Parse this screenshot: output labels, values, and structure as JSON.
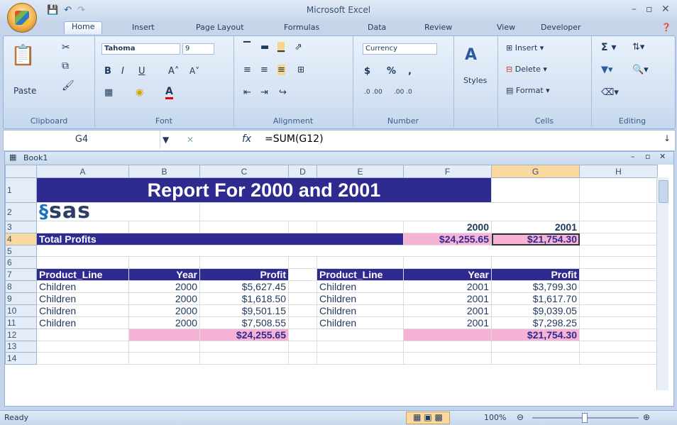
{
  "app": {
    "title": "Microsoft Excel"
  },
  "tabs": [
    "Home",
    "Insert",
    "Page Layout",
    "Formulas",
    "Data",
    "Review",
    "View",
    "Developer"
  ],
  "ribbon": {
    "clipboard": {
      "label": "Clipboard",
      "paste": "Paste"
    },
    "font": {
      "label": "Font",
      "name": "Tahoma",
      "size": "9",
      "bold": "B",
      "italic": "I",
      "underline": "U",
      "grow": "A˄",
      "shrink": "A˅",
      "font_color": "A"
    },
    "alignment": {
      "label": "Alignment"
    },
    "number": {
      "label": "Number",
      "format": "Currency",
      "dollar": "$",
      "percent": "%",
      "comma": ",",
      "inc_dec": ".0 .00",
      "dec_dec": ".00 .0"
    },
    "styles": {
      "label": "Styles"
    },
    "cells": {
      "label": "Cells",
      "insert": "Insert",
      "delete": "Delete",
      "format": "Format"
    },
    "editing": {
      "label": "Editing",
      "sum": "Σ"
    }
  },
  "formula_bar": {
    "name_box": "G4",
    "fx": "fx",
    "formula": "=SUM(G12)"
  },
  "workbook": {
    "title": "Book1"
  },
  "columns": [
    "A",
    "B",
    "C",
    "D",
    "E",
    "F",
    "G",
    "H"
  ],
  "rows": [
    "1",
    "2",
    "3",
    "4",
    "5",
    "6",
    "7",
    "8",
    "9",
    "10",
    "11",
    "12",
    "13",
    "14"
  ],
  "sheet": {
    "report_title": "Report For 2000 and 2001",
    "logo_text": "sas",
    "year_2000": "2000",
    "year_2001": "2001",
    "total_profits_label": "Total Profits",
    "total_2000": "$24,255.65",
    "total_2001": "$21,754.30",
    "headers": [
      "Product_Line",
      "Year",
      "Profit"
    ],
    "left_rows": [
      [
        "Children",
        "2000",
        "$5,627.45"
      ],
      [
        "Children",
        "2000",
        "$1,618.50"
      ],
      [
        "Children",
        "2000",
        "$9,501.15"
      ],
      [
        "Children",
        "2000",
        "$7,508.55"
      ]
    ],
    "right_rows": [
      [
        "Children",
        "2001",
        "$3,799.30"
      ],
      [
        "Children",
        "2001",
        "$1,617.70"
      ],
      [
        "Children",
        "2001",
        "$9,039.05"
      ],
      [
        "Children",
        "2001",
        "$7,298.25"
      ]
    ],
    "left_total": "$24,255.65",
    "right_total": "$21,754.30"
  },
  "status": {
    "text": "Ready",
    "zoom": "100%"
  },
  "colors": {
    "navy": "#2e2a8f",
    "pink": "#f7b3d5",
    "selected_header": "#f9d99f"
  },
  "icons": [
    "office-button-icon",
    "save-icon",
    "undo-icon",
    "redo-icon",
    "paste-icon",
    "cut-icon",
    "copy-icon",
    "format-painter-icon",
    "styles-icon",
    "insert-cells-icon",
    "delete-cells-icon",
    "format-cells-icon",
    "autosum-icon",
    "sort-filter-icon",
    "find-icon",
    "help-icon"
  ]
}
